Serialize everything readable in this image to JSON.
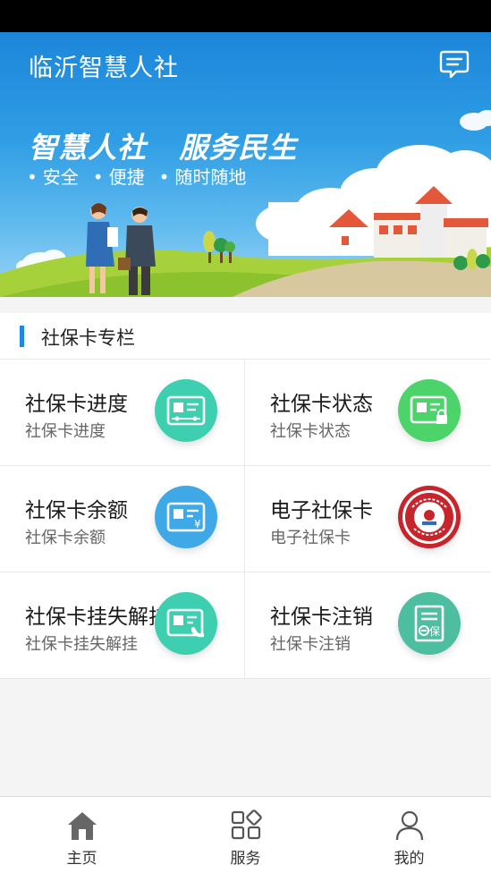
{
  "header": {
    "title": "临沂智慧人社",
    "message_icon": "message-icon"
  },
  "banner": {
    "slogan": "智慧人社   服务民生",
    "tags": [
      "安全",
      "便捷",
      "随时随地"
    ]
  },
  "section": {
    "title": "社保卡专栏"
  },
  "cards": [
    {
      "title": "社保卡进度",
      "subtitle": "社保卡进度",
      "icon": "card-progress-icon",
      "color": "#3ecfb0"
    },
    {
      "title": "社保卡状态",
      "subtitle": "社保卡状态",
      "icon": "card-status-icon",
      "color": "#4cd46a"
    },
    {
      "title": "社保卡余额",
      "subtitle": "社保卡余额",
      "icon": "card-balance-icon",
      "color": "#3ea9e6"
    },
    {
      "title": "电子社保卡",
      "subtitle": "电子社保卡",
      "icon": "e-social-card-icon",
      "color": "#c8242b"
    },
    {
      "title": "社保卡挂失解挂",
      "subtitle": "社保卡挂失解挂",
      "icon": "card-report-loss-icon",
      "color": "#3ecfb0"
    },
    {
      "title": "社保卡注销",
      "subtitle": "社保卡注销",
      "icon": "card-cancel-icon",
      "color": "#4dbfa0"
    }
  ],
  "tabbar": [
    {
      "label": "主页",
      "icon": "home-icon"
    },
    {
      "label": "服务",
      "icon": "services-grid-icon"
    },
    {
      "label": "我的",
      "icon": "profile-icon"
    }
  ],
  "colors": {
    "accent": "#1e88e5",
    "banner_top": "#1c86da"
  }
}
